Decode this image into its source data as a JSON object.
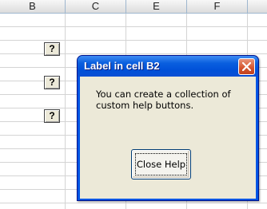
{
  "spreadsheet": {
    "column_headers": [
      "B",
      "C",
      "E",
      "F"
    ],
    "help_buttons": [
      "?",
      "?",
      "?"
    ]
  },
  "dialog": {
    "title": "Label in cell B2",
    "message": "You can create a collection of custom help buttons.",
    "close_button_label": "Close Help",
    "title_close_icon": "close-x-icon",
    "colors": {
      "titlebar": "#0a5fdf",
      "frame": "#0055e5",
      "client": "#ece9d8",
      "close_icon_bg": "#d4532c"
    }
  }
}
